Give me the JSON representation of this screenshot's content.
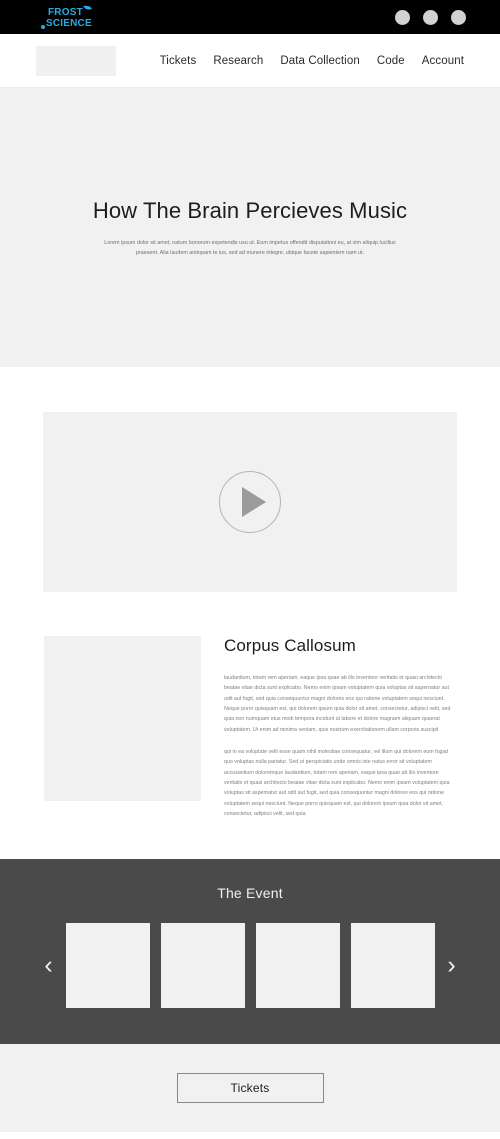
{
  "topbar": {
    "logo": {
      "line1": "FROST",
      "line2": "SCIENCE",
      "color": "#29abe2",
      "mark_icon": "leaf-swoosh-icon",
      "dot_icon": "dot-icon"
    },
    "actions": [
      {
        "icon": "circle-avatar-icon"
      },
      {
        "icon": "circle-avatar-icon"
      },
      {
        "icon": "circle-avatar-icon"
      }
    ],
    "background": "#000000"
  },
  "nav": {
    "logo_placeholder": "",
    "links": [
      {
        "label": "Tickets"
      },
      {
        "label": "Research"
      },
      {
        "label": "Data Collection"
      },
      {
        "label": "Code"
      },
      {
        "label": "Account"
      }
    ]
  },
  "hero": {
    "title": "How The Brain Percieves Music",
    "subtitle": "Lorem ipsum dolor sit amet, natum bonorum expetendis usu ut. Eum impetus offendit disputationi eu, at vim aliquip lucilius praesent. Alia laudem antiopam te ius, sed ad munere integre, ubique facete sapientem nam ut.",
    "background": "#f1f1f1"
  },
  "video": {
    "play_icon": "play-triangle-icon",
    "placeholder_color": "#f1f1f1"
  },
  "article": {
    "image_placeholder": "",
    "title": "Corpus Callosum",
    "paragraphs": [
      "laudantium, totam rem aperiam, eaque ipsa quae ab illo inventore veritatis et quasi architecto beatae vitae dicta sunt explicabo. Nemo enim ipsam voluptatem quia voluptas sit aspernatur aut odit aut fugit, sed quia consequuntur magni dolores eos qui ratione voluptatem sequi nesciunt. Neque porro quisquam est, qui dolorem ipsum quia dolor sit amet, consectetur, adipisci velit, sed quia non numquam eius modi tempora incidunt ut labore et dolore magnam aliquam quaerat voluptatem. Ut enim ad minima veniam, quis nostrum exercitationem ullam corporis suscipit",
      "qui in ea voluptate velit esse quam nihil molestiae consequatur, vel illum qui dolorem eum fugiat quo voluptas nulla pariatur. Sed ut perspiciatis unde omnis iste natus error sit voluptatem accusantium doloremque laudantium, totam rem aperiam, eaque ipsa quae ab illo inventore veritatis et quasi architecto beatae vitae dicta sunt explicabo. Nemo enim ipsam voluptatem quia voluptas sit aspernatur aut odit aut fugit, sed quia consequuntur magni dolores eos qui ratione voluptatem sequi nesciunt. Neque porro quisquam est, qui dolorem ipsum quia dolor sit amet, consectetur, adipisci velit, sed quia"
    ]
  },
  "event": {
    "title": "The Event",
    "background": "#4a4a4a",
    "prev_label": "‹",
    "next_label": "›",
    "slides": [
      {
        "caption": ""
      },
      {
        "caption": ""
      },
      {
        "caption": ""
      },
      {
        "caption": ""
      }
    ]
  },
  "footer": {
    "cta_label": "Tickets"
  }
}
